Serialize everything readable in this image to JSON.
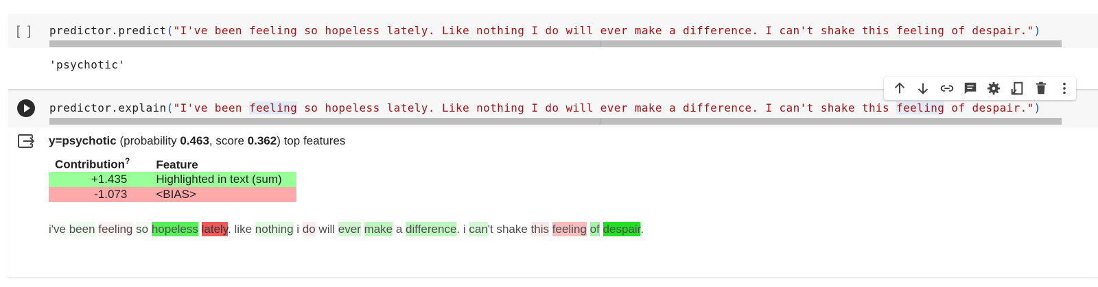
{
  "cells": [
    {
      "run_indicator": "[ ]",
      "code": {
        "func": "predictor.predict",
        "open": "(",
        "string": "\"I've been feeling so hopeless lately. Like nothing I do will ever make a difference. I can't shake this feeling of despair.\"",
        "close": ")"
      },
      "output": "'psychotic'"
    },
    {
      "code": {
        "func": "predictor.explain",
        "open": "(",
        "string_parts": [
          {
            "text": "\"I've been ",
            "hl": false
          },
          {
            "text": "feeling",
            "hl": true
          },
          {
            "text": " so hopeless lately. Like nothing I do will ever make a difference. I can't shake this ",
            "hl": false
          },
          {
            "text": "feeling",
            "hl": true
          },
          {
            "text": " of despair.\"",
            "hl": false
          }
        ],
        "close": ")"
      },
      "output": {
        "summary": {
          "target": "y=psychotic",
          "prob_prefix": " (probability ",
          "probability": "0.463",
          "score_prefix": ", score ",
          "score": "0.362",
          "suffix": ") top features"
        },
        "table": {
          "headers": [
            "Contribution",
            "Feature"
          ],
          "header_sup": "?",
          "rows": [
            {
              "contribution": "+1.435",
              "feature": "Highlighted in text (sum)",
              "color": "#99ff99"
            },
            {
              "contribution": "-1.073",
              "feature": "<BIAS>",
              "color": "#ffaaaa"
            }
          ]
        },
        "tokens": [
          {
            "t": "i've",
            "bg": "#f5fdf5"
          },
          {
            "t": " ",
            "bg": null
          },
          {
            "t": "been",
            "bg": "#eefcee"
          },
          {
            "t": " ",
            "bg": null
          },
          {
            "t": "feeling",
            "bg": "#fdf0f0"
          },
          {
            "t": " ",
            "bg": null
          },
          {
            "t": "so",
            "bg": "#f1fcf1"
          },
          {
            "t": " ",
            "bg": null
          },
          {
            "t": "hopeless",
            "bg": "#58f058"
          },
          {
            "t": " ",
            "bg": null
          },
          {
            "t": "lately",
            "bg": "#ee5a5a"
          },
          {
            "t": ". like ",
            "bg": null
          },
          {
            "t": "nothing",
            "bg": "#e1fbe1"
          },
          {
            "t": " i ",
            "bg": null
          },
          {
            "t": "do",
            "bg": "#fdeaea"
          },
          {
            "t": " will ",
            "bg": null
          },
          {
            "t": "ever",
            "bg": "#cff8cf"
          },
          {
            "t": " ",
            "bg": null
          },
          {
            "t": "make",
            "bg": "#bff6bf"
          },
          {
            "t": " a ",
            "bg": null
          },
          {
            "t": "difference",
            "bg": "#bff6bf"
          },
          {
            "t": ". i ",
            "bg": null
          },
          {
            "t": "can",
            "bg": "#d4f9d4"
          },
          {
            "t": "'t shake ",
            "bg": null
          },
          {
            "t": "this",
            "bg": "#fde8e8"
          },
          {
            "t": " ",
            "bg": null
          },
          {
            "t": "feeling",
            "bg": "#f7bcbc"
          },
          {
            "t": " ",
            "bg": null
          },
          {
            "t": "of",
            "bg": "#aaf3aa"
          },
          {
            "t": " ",
            "bg": null
          },
          {
            "t": "despair",
            "bg": "#22e022"
          },
          {
            "t": ".",
            "bg": null
          }
        ]
      },
      "toolbar": [
        "move-up-icon",
        "move-down-icon",
        "link-icon",
        "comment-icon",
        "settings-icon",
        "mirror-cell-icon",
        "delete-icon",
        "more-vert-icon"
      ]
    }
  ],
  "colors": {
    "string": "#a31515",
    "paren": "#1a4fd6",
    "positive": "#99ff99",
    "negative": "#ffaaaa"
  }
}
